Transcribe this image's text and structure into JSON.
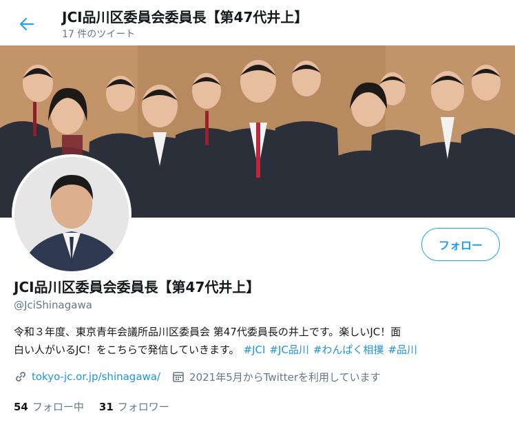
{
  "header": {
    "title": "JCI品川区委員会委員長【第47代井上】",
    "tweet_count": "17 件のツイート"
  },
  "profile": {
    "display_name": "JCI品川区委員会委員長【第47代井上】",
    "handle": "@JciShinagawa",
    "follow_label": "フォロー",
    "bio_line1": "令和３年度、東京青年会議所品川区委員会 第47代委員長の井上です。楽しいJC！面",
    "bio_line2": "白い人がいるJC！をこちらで発信していきます。",
    "hashtags": [
      "#JCI",
      "#JC品川",
      "#わんぱく相撲",
      "#品川"
    ],
    "website": "tokyo-jc.or.jp/shinagawa/",
    "joined": "2021年5月からTwitterを利用しています",
    "following_count": "54",
    "following_label": "フォロー中",
    "followers_count": "31",
    "followers_label": "フォロワー"
  },
  "icons": [
    "back-arrow-icon",
    "link-icon",
    "calendar-icon"
  ],
  "colors": {
    "accent": "#1da1f2",
    "link": "#1b95e0",
    "muted": "#657786",
    "text": "#14171a"
  }
}
